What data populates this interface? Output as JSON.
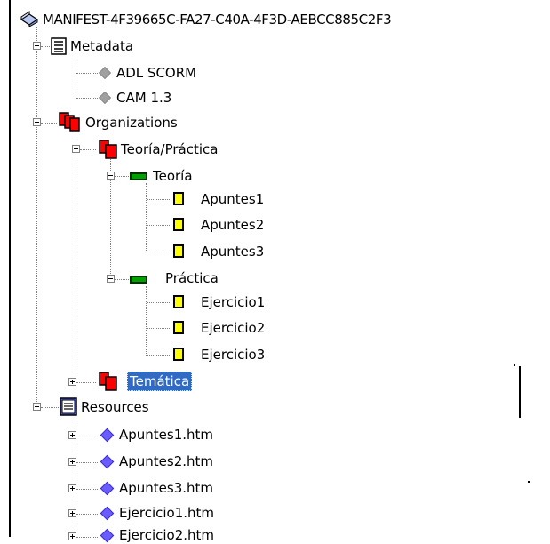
{
  "tree": {
    "root_label": "MANIFEST-4F39665C-FA27-C40A-4F3D-AEBCC885C2F3",
    "metadata": {
      "label": "Metadata",
      "children": [
        "ADL SCORM",
        "CAM 1.3"
      ]
    },
    "organizations": {
      "label": "Organizations",
      "org": {
        "label": "Teoría/Práctica",
        "teoria": {
          "label": "Teoría",
          "children": [
            "Apuntes1",
            "Apuntes2",
            "Apuntes3"
          ]
        },
        "practica": {
          "label": "Práctica",
          "children": [
            "Ejercicio1",
            "Ejercicio2",
            "Ejercicio3"
          ]
        }
      },
      "tematica": {
        "label": "Temática"
      }
    },
    "resources": {
      "label": "Resources",
      "children": [
        "Apuntes1.htm",
        "Apuntes2.htm",
        "Apuntes3.htm",
        "Ejercicio1.htm",
        "Ejercicio2.htm"
      ]
    }
  },
  "colors": {
    "selection": "#316ac5",
    "organization_red": "#ff0000",
    "item_green": "#00a000",
    "leaf_yellow": "#ffff00",
    "resource_blue": "#6a5cff"
  }
}
